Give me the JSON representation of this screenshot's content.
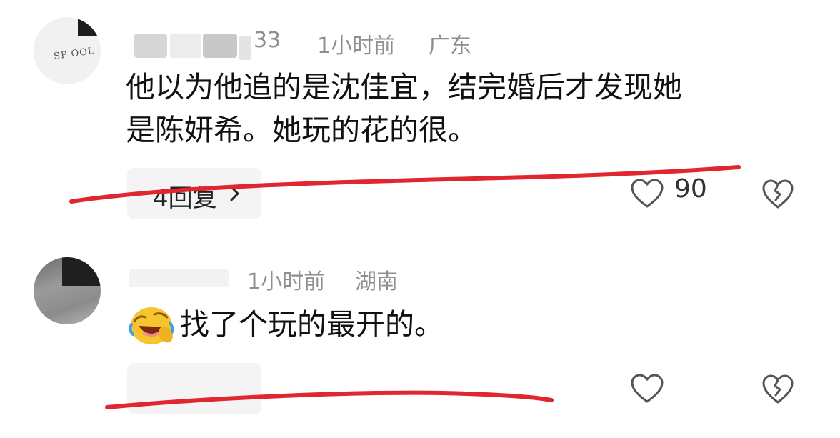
{
  "comments": [
    {
      "handle_fragment": "33",
      "time": "1小时前",
      "location": "广东",
      "content_line1": "他以为他追的是沈佳宜，结完婚后才发现她",
      "content_line2": "是陈妍希。她玩的花的很。",
      "reply_label": "4回复",
      "like_count": "90",
      "avatar_text": "SP OOL"
    },
    {
      "time": "1小时前",
      "location": "湖南",
      "content": "找了个玩的最开的。",
      "emoji_icon": "rolling-on-floor-laughing-emoji"
    }
  ],
  "icons": {
    "like": "heart-outline-icon",
    "dislike": "broken-heart-icon",
    "reply_chevron": "chevron-right-icon"
  },
  "colors": {
    "annotation_stroke": "#e0262e",
    "meta_text": "#8f8f8f"
  }
}
